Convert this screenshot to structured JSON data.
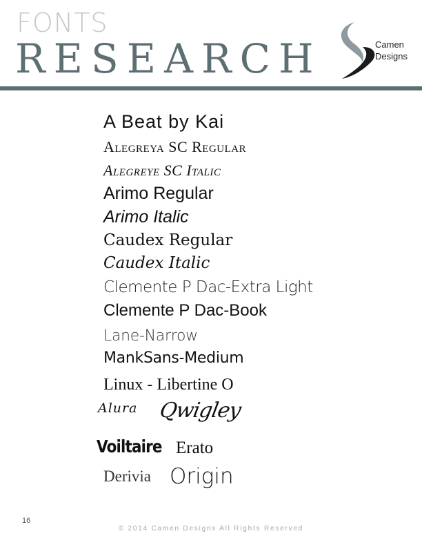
{
  "header": {
    "small_title": "FONTS",
    "large_title": "RESEARCH",
    "accent_color": "#5e6f74",
    "logo": {
      "icon": "camen-swoosh-logo",
      "line1": "Camen",
      "line2": "Designs"
    }
  },
  "fonts": {
    "beat": "A Beat by Kai",
    "alegreya_regular": "Alegreya SC Regular",
    "alegreya_italic": "Alegreye SC Italic",
    "arimo_regular": "Arimo Regular",
    "arimo_italic": "Arimo Italic",
    "caudex_regular": "Caudex Regular",
    "caudex_italic": "Caudex Italic",
    "clemente_light": "Clemente P Dac-Extra Light",
    "clemente_book": "Clemente P Dac-Book",
    "lane_narrow": "Lane-Narrow",
    "mank_sans": "MankSans-Medium",
    "linux_libertine": "Linux - Libertine O",
    "alura": "Alura",
    "qwigley": "Qwigley",
    "voiltaire": "Voiltaire",
    "erato": "Erato",
    "derivia": "Derivia",
    "origin": "Origin"
  },
  "footer": {
    "page_number": "16",
    "copyright": "© 2014  Camen  Designs  All  Rights  Reserved"
  }
}
